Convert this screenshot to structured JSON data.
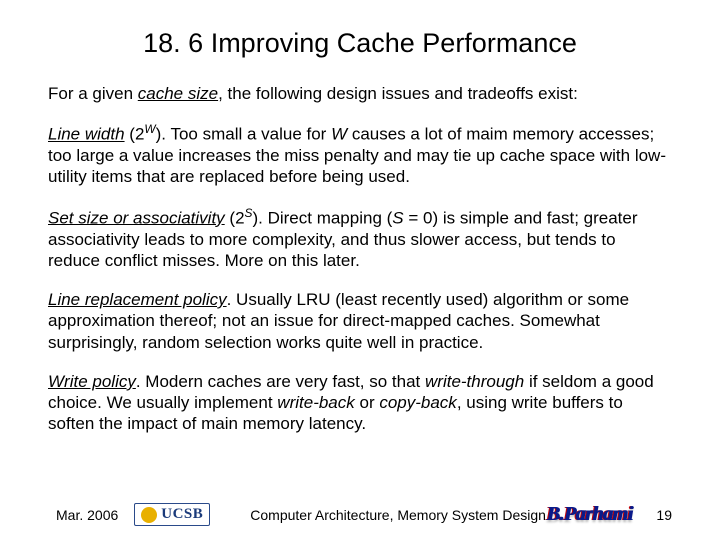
{
  "title": "18. 6  Improving Cache Performance",
  "intro_pre": "For a given ",
  "intro_term": "cache size",
  "intro_post": ", the following design issues and tradeoffs exist:",
  "p1_term": "Line width",
  "p1_mid": " (2",
  "p1_sup": "W",
  "p1_rest": "). Too small a value for ",
  "p1_var": "W",
  "p1_tail": " causes a lot of maim memory accesses; too large a value increases the miss penalty and may tie up cache space with low-utility items that are replaced before being used.",
  "p2_term": "Set size or associativity",
  "p2_mid": " (2",
  "p2_sup": "S",
  "p2_rest": "). Direct mapping (",
  "p2_var": "S",
  "p2_tail": " = 0) is simple and fast; greater associativity leads to more complexity, and thus slower access, but tends to reduce conflict misses. More on this later.",
  "p3_term": "Line replacement policy",
  "p3_tail": ". Usually LRU (least recently used) algorithm or some approximation thereof; not an issue for direct-mapped caches. Somewhat surprisingly, random selection works quite well in practice.",
  "p4_term": "Write policy",
  "p4_a": ". Modern caches are very fast, so that ",
  "p4_wt": "write-through",
  "p4_b": " if seldom a good choice. We usually implement ",
  "p4_wb": "write-back",
  "p4_c": " or ",
  "p4_cb": "copy-back",
  "p4_d": ", using write buffers to soften the impact of main memory latency.",
  "footer": {
    "date": "Mar. 2006",
    "logo": "UCSB",
    "center": "Computer Architecture, Memory System Design",
    "author": "B.Parhami",
    "page": "19"
  }
}
